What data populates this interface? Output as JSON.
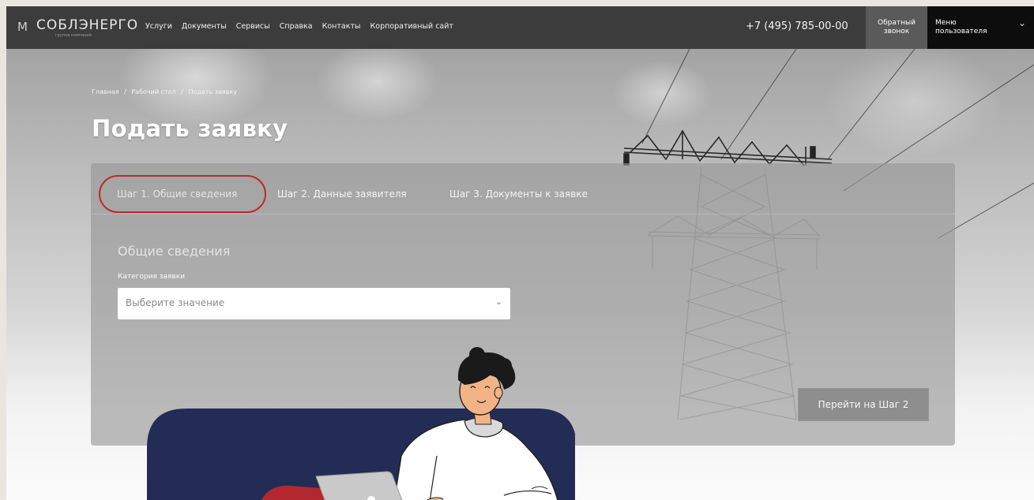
{
  "header": {
    "logo_mark": "М",
    "logo_name": "СОБЛЭНЕРГО",
    "logo_tagline": "группа компаний",
    "nav": [
      "Услуги",
      "Документы",
      "Сервисы",
      "Справка",
      "Контакты",
      "Корпоративный сайт"
    ],
    "phone": "+7 (495) 785-00-00",
    "callback_label": "Обратный звонок",
    "user_menu_label": "Меню пользователя",
    "user_menu_chevron": "⌄"
  },
  "breadcrumb": [
    "Главная",
    "/",
    "Рабочий стол",
    "/",
    "Подать заявку"
  ],
  "page_title": "Подать заявку",
  "tabs": [
    {
      "label": "Шаг 1. Общие сведения",
      "active": true
    },
    {
      "label": "Шаг 2. Данные заявителя",
      "active": false
    },
    {
      "label": "Шаг 3. Документы к заявке",
      "active": false
    }
  ],
  "form": {
    "section_title": "Общие сведения",
    "category_label": "Категория заявки",
    "category_placeholder": "Выберите значение",
    "select_chevron": "⌄",
    "next_button": "Перейти на Шаг 2"
  },
  "colors": {
    "header_bg": "#3c3c3c",
    "user_menu_bg": "#0d0d0d",
    "highlight": "#c0282d",
    "illustration_bg": "#232c55"
  }
}
